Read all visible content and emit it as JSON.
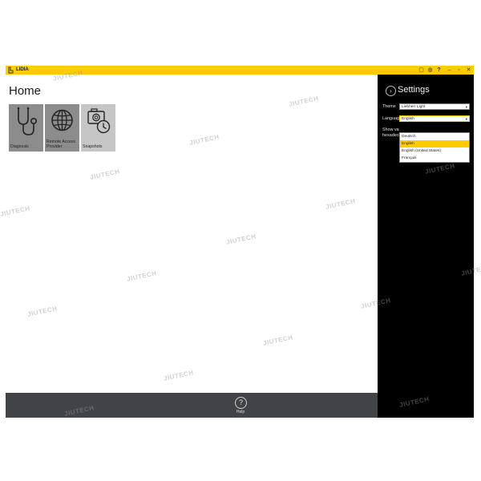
{
  "window": {
    "title": "LIDIA",
    "titlebar_icons": [
      "chat-icon",
      "globe-icon",
      "help-icon",
      "minimize-icon",
      "maximize-icon",
      "close-icon"
    ],
    "titlebar_glyphs": [
      "▢",
      "◍",
      "?",
      "–",
      "▫",
      "✕"
    ]
  },
  "home": {
    "title": "Home",
    "tiles": [
      {
        "label": "Diagnosis",
        "icon": "stethoscope-icon"
      },
      {
        "label": "Remote Access Provider",
        "icon": "globe-icon"
      },
      {
        "label": "Snapshots",
        "icon": "camera-clock-icon"
      }
    ]
  },
  "bottom_bar": {
    "help_label": "Help",
    "help_glyph": "?"
  },
  "settings": {
    "back_glyph": "›",
    "title": "Settings",
    "theme_label": "Theme",
    "theme_value": "Liebherr Light",
    "language_label": "Language",
    "language_value": "English",
    "show_label_1": "Show varia",
    "show_label_2": "hexadecim",
    "language_options": [
      "Deutsch",
      "English",
      "English (United States)",
      "Français"
    ],
    "selected_option": "English",
    "dropdown_arrow": "▾"
  },
  "watermark": "JIUTECH",
  "colors": {
    "accent": "#ffcc00",
    "tile_dark": "#8c8c8c",
    "tile_light": "#c6c6c6",
    "settings_bg": "#000000",
    "bottom_bar": "#404348"
  }
}
